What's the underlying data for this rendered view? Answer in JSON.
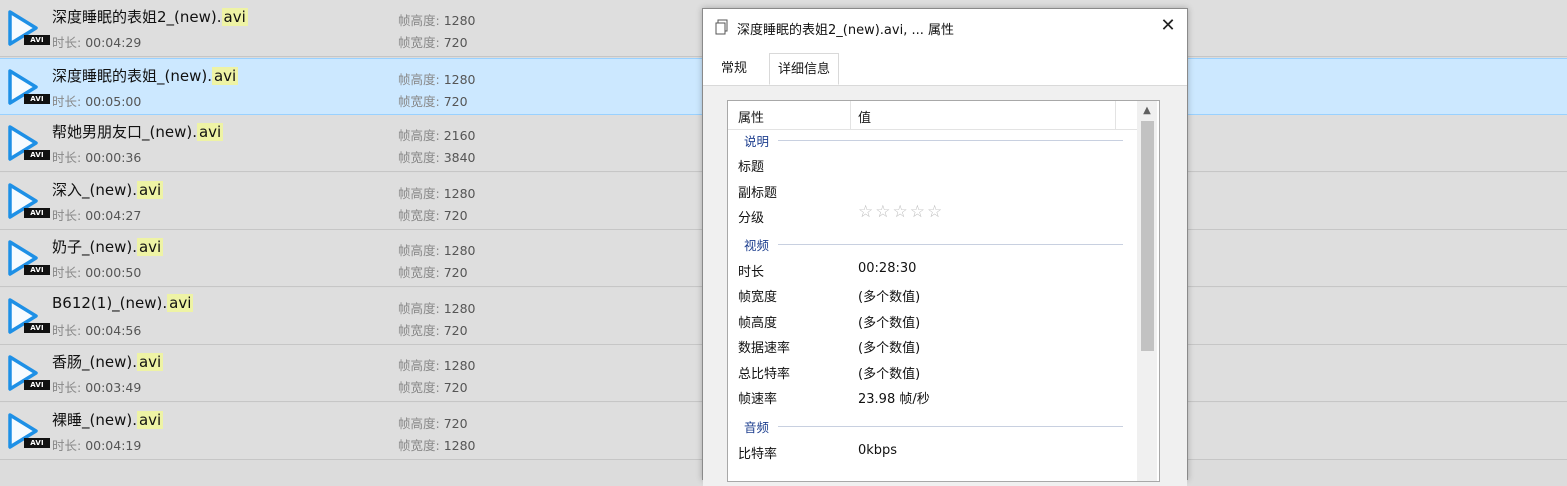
{
  "file_list": {
    "duration_label": "时长:",
    "height_label": "帧高度:",
    "width_label": "帧宽度:",
    "badge": "AVI",
    "rows": [
      {
        "name": "深度睡眠的表姐2_(new).",
        "ext": "avi",
        "duration": "00:04:29",
        "frame_height": "1280",
        "frame_width": "720",
        "selected": false
      },
      {
        "name": "深度睡眠的表姐_(new).",
        "ext": "avi",
        "duration": "00:05:00",
        "frame_height": "1280",
        "frame_width": "720",
        "selected": true
      },
      {
        "name": "帮她男朋友口_(new).",
        "ext": "avi",
        "duration": "00:00:36",
        "frame_height": "2160",
        "frame_width": "3840",
        "selected": false
      },
      {
        "name": "深入_(new).",
        "ext": "avi",
        "duration": "00:04:27",
        "frame_height": "1280",
        "frame_width": "720",
        "selected": false
      },
      {
        "name": "奶子_(new).",
        "ext": "avi",
        "duration": "00:00:50",
        "frame_height": "1280",
        "frame_width": "720",
        "selected": false
      },
      {
        "name": "B612(1)_(new).",
        "ext": "avi",
        "duration": "00:04:56",
        "frame_height": "1280",
        "frame_width": "720",
        "selected": false
      },
      {
        "name": "香肠_(new).",
        "ext": "avi",
        "duration": "00:03:49",
        "frame_height": "1280",
        "frame_width": "720",
        "selected": false
      },
      {
        "name": "裸睡_(new).",
        "ext": "avi",
        "duration": "00:04:19",
        "frame_height": "720",
        "frame_width": "1280",
        "selected": false
      }
    ]
  },
  "dialog": {
    "title": "深度睡眠的表姐2_(new).avi, ... 属性",
    "close_glyph": "✕",
    "tabs": [
      {
        "label": "常规",
        "active": false
      },
      {
        "label": "详细信息",
        "active": true
      }
    ],
    "header": {
      "property": "属性",
      "value": "值"
    },
    "sections": {
      "description": "说明",
      "video": "视频",
      "audio": "音频"
    },
    "props": {
      "title": {
        "name": "标题",
        "value": ""
      },
      "subtitle": {
        "name": "副标题",
        "value": ""
      },
      "rating": {
        "name": "分级",
        "stars": "☆☆☆☆☆",
        "rating_value": 0,
        "max": 5
      },
      "length": {
        "name": "时长",
        "value": "00:28:30"
      },
      "frame_width": {
        "name": "帧宽度",
        "value": "(多个数值)"
      },
      "frame_height": {
        "name": "帧高度",
        "value": "(多个数值)"
      },
      "data_rate": {
        "name": "数据速率",
        "value": "(多个数值)"
      },
      "total_bitrate": {
        "name": "总比特率",
        "value": "(多个数值)"
      },
      "frame_rate": {
        "name": "帧速率",
        "value": "23.98 帧/秒"
      },
      "bitrate": {
        "name": "比特率",
        "value": "0kbps"
      }
    }
  },
  "colors": {
    "selection": "#cce8ff",
    "play_icon": "#1e90e6",
    "ext_highlight": "#eef3a5",
    "section_text": "#1e3f8f"
  }
}
